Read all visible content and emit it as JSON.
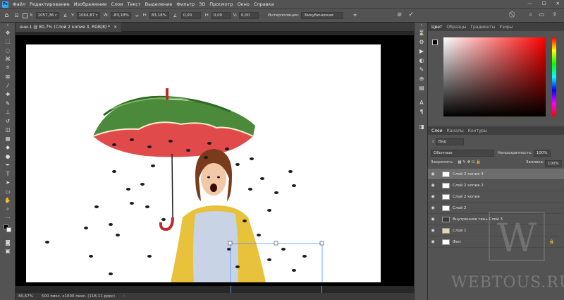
{
  "menu": {
    "app_icon": "Ps",
    "items": [
      "Файл",
      "Редактирование",
      "Изображение",
      "Слои",
      "Текст",
      "Выделение",
      "Фильтр",
      "3D",
      "Просмотр",
      "Окно",
      "Справка"
    ],
    "window_controls": [
      "—",
      "☐",
      "✕"
    ]
  },
  "options": {
    "x_label": "X:",
    "x_value": "1057,36 г",
    "y_label": "Y:",
    "y_value": "1064,87 г",
    "w_label": "W:",
    "w_value": "-83,18%",
    "h_label": "H:",
    "h_value": "83,18%",
    "angle_value": "0,00",
    "h_skew_label": "H:",
    "h_skew_value": "0,00",
    "v_skew_label": "V:",
    "v_skew_value": "0,00",
    "interp_label": "Интерполяция:",
    "interp_value": "Бикубическая",
    "cancel_icon": "cancel-icon",
    "commit_icon": "check-icon"
  },
  "document": {
    "tab_title": "ени-1 @ 80,7% (Слой 2 копия 3, RGB/8) *",
    "status_zoom": "80,67%",
    "status_info": "500 пикс. x1000 пикс. (118,11 pppc)"
  },
  "color_panel": {
    "tabs": [
      "Цвет",
      "Образцы",
      "Градиенты",
      "Узоры"
    ],
    "active_tab": "Цвет",
    "accent": "#ff0000"
  },
  "layers_panel": {
    "tabs": [
      "Слои",
      "Каналы",
      "Контуры"
    ],
    "active_tab": "Слои",
    "search_placeholder": "Вид",
    "blend_mode": "Обычные",
    "opacity_label": "Непрозрачность:",
    "opacity_value": "100%",
    "lock_label": "Закрепить:",
    "fill_label": "Заливка:",
    "fill_value": "100%",
    "layers": [
      {
        "name": "Слой 2 копия 3",
        "selected": true
      },
      {
        "name": "Слой 2 копия 2",
        "selected": false
      },
      {
        "name": "Слой 2 копия",
        "selected": false
      },
      {
        "name": "Слой 2",
        "selected": false
      },
      {
        "name": "Внутренняя тень Слой 3",
        "selected": false
      },
      {
        "name": "Слой 1",
        "selected": false
      },
      {
        "name": "Фон",
        "selected": false
      }
    ]
  },
  "watermark": "WEBTOUS.RU"
}
